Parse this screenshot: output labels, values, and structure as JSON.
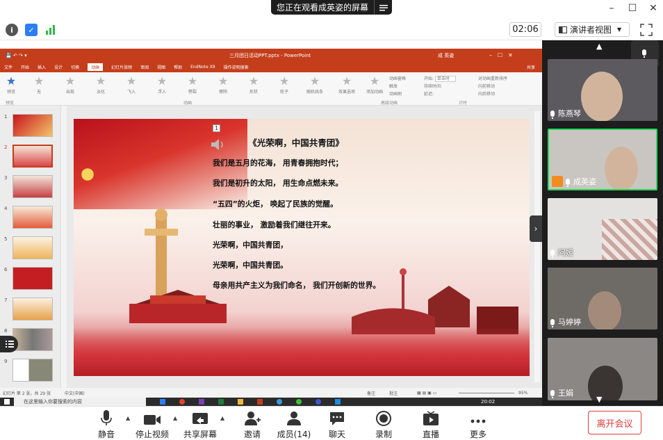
{
  "banner": {
    "text": "您正在观看成英姿的屏幕",
    "menu_icon": "menu-icon"
  },
  "toolbar": {
    "timer": "02:06",
    "view_label": "演讲者视图",
    "icons": [
      "info-icon",
      "shield-icon",
      "signal-icon"
    ]
  },
  "ppt": {
    "title": "三月团日活动PPT.pptx - PowerPoint",
    "user": "成 英姿",
    "share": "共享",
    "tabs": [
      "文件",
      "开始",
      "插入",
      "设计",
      "切换",
      "动画",
      "幻灯片放映",
      "审阅",
      "视图",
      "帮助",
      "EndNote X9",
      "操作说明搜索"
    ],
    "selected_tab": "动画",
    "preview": "预览",
    "animations": [
      "无",
      "出现",
      "淡化",
      "飞入",
      "浮入",
      "劈裂",
      "擦除",
      "形状",
      "轮子",
      "随机线条"
    ],
    "effect_options": "效果选项",
    "add_animation": "添加动画",
    "animation_pane": "动画窗格",
    "trigger": "触发",
    "anim_brush": "动画刷",
    "start_label": "开始:",
    "start_value": "单击时",
    "duration_label": "持续时间:",
    "delay_label": "延迟:",
    "reorder": "对动画重新排序",
    "move_earlier": "向前移动",
    "move_later": "向后移动",
    "group_preview": "预览",
    "group_anim": "动画",
    "group_adv": "高级动画",
    "group_timing": "计时",
    "thumb_numbers": [
      "1",
      "2",
      "3",
      "4",
      "5",
      "6",
      "7",
      "8",
      "9"
    ],
    "status_left": "幻灯片 第 2 张，共 29 张",
    "status_lang": "中文(中国)",
    "status_notes": "备注",
    "status_comments": "批注",
    "zoom": "95%",
    "taskbar_search": "在这里输入你要搜索的内容",
    "taskbar_time": "20:02"
  },
  "slide": {
    "anim_tag": "1",
    "title": "《光荣啊，中国共青团》",
    "lines": [
      "我们是五月的花海， 用青春拥抱时代；",
      "我们是初升的太阳， 用生命点燃未来。",
      "“五四”的火炬， 唤起了民族的觉醒。",
      "壮丽的事业， 激励着我们继往开来。",
      "光荣啊，中国共青团，",
      "光荣啊，中国共青团。",
      "母亲用共产主义为我们命名， 我们开创新的世界。"
    ]
  },
  "participants": [
    {
      "name": "陈燕琴",
      "bg": "#5c5a5e"
    },
    {
      "name": "成英姿",
      "bg": "#c9c6c2",
      "active": true
    },
    {
      "name": "阿媛",
      "bg": "#e4e2e0"
    },
    {
      "name": "马婷婷",
      "bg": "#6e6a66"
    },
    {
      "name": "王娟",
      "bg": "#8a8784"
    }
  ],
  "controls": {
    "mute": "静音",
    "stop_video": "停止视频",
    "share_screen": "共享屏幕",
    "invite": "邀请",
    "members": "成员(14)",
    "chat": "聊天",
    "record": "录制",
    "live": "直播",
    "more": "更多",
    "leave": "离开会议"
  },
  "colors": {
    "ppt_red": "#c43e1c",
    "active_border": "#23d959",
    "leave_red": "#e03c3c"
  }
}
